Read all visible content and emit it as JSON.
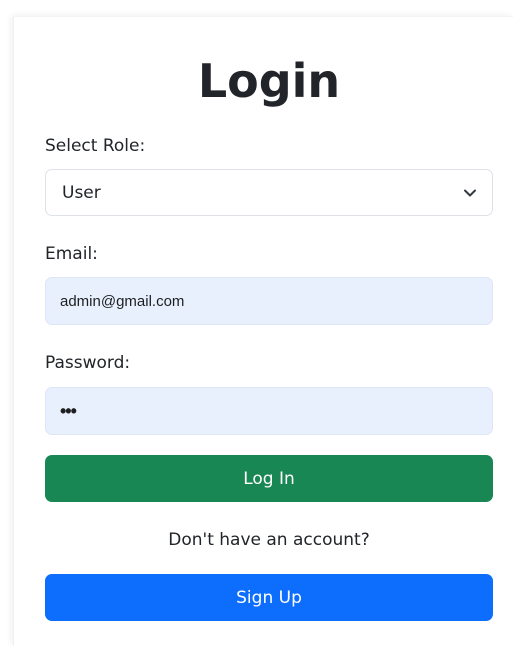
{
  "form": {
    "title": "Login",
    "role_label": "Select Role:",
    "role_value": "User",
    "email_label": "Email:",
    "email_value": "admin@gmail.com",
    "password_label": "Password:",
    "password_value": "•••",
    "login_button": "Log In",
    "signup_prompt": "Don't have an account?",
    "signup_button": "Sign Up"
  },
  "icons": {
    "select_arrow": "chevron-down-icon"
  },
  "colors": {
    "login_button": "#198754",
    "signup_button": "#0d6efd",
    "autofill_background": "#e8f0fe"
  }
}
